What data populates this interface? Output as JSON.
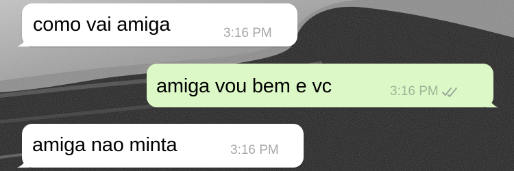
{
  "conversation": {
    "messages": [
      {
        "direction": "incoming",
        "text": "como vai amiga",
        "time": "3:16 PM"
      },
      {
        "direction": "outgoing",
        "text": "amiga vou bem e vc",
        "time": "3:16 PM",
        "status_icon": "double-check-icon"
      },
      {
        "direction": "incoming",
        "text": "amiga nao minta",
        "time": "3:16 PM"
      }
    ]
  },
  "colors": {
    "incoming_bubble": "#ffffff",
    "outgoing_bubble": "#dcf8c6",
    "timestamp": "#a7a7a7",
    "wallpaper": "#1b1b1b"
  }
}
